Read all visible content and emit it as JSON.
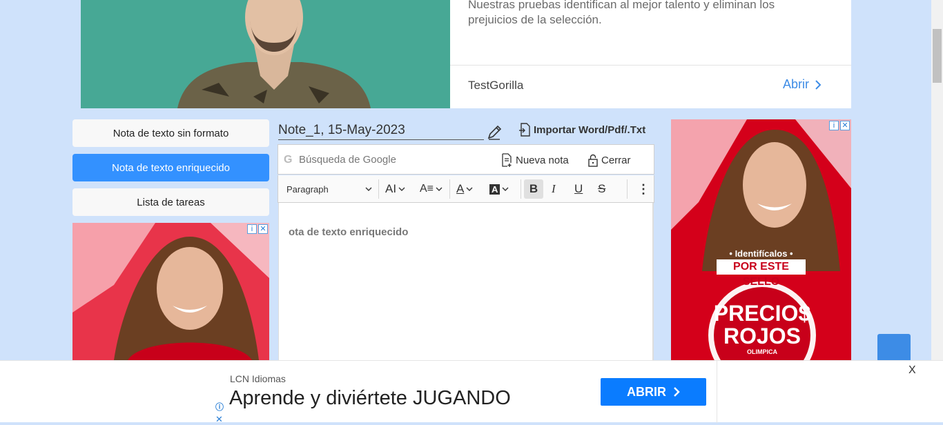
{
  "top_ad": {
    "text": "Nuestras pruebas identifican al mejor talento y eliminan los prejuicios de la selección.",
    "brand": "TestGorilla",
    "open_label": "Abrir"
  },
  "nav": {
    "plain": "Nota de texto sin formato",
    "rich": "Nota de texto enriquecido",
    "tasks": "Lista de tareas"
  },
  "editor": {
    "note_title": "Note_1, 15-May-2023",
    "import_label": "Importar Word/Pdf/.Txt",
    "search_placeholder": "Búsqueda de Google",
    "new_note_label": "Nueva nota",
    "close_label": "Cerrar",
    "toolbar": {
      "paragraph": "Paragraph"
    },
    "content": "ota de texto enriquecido"
  },
  "side_ad": {
    "tagline": "• Identifícalos •",
    "badge": "POR ESTE SELLO",
    "big": "PRECIO$ ROJOS",
    "brand": "OLIMPICA"
  },
  "bottom_ad": {
    "brand": "LCN Idiomas",
    "headline": "Aprende y diviértete JUGANDO",
    "open_label": "ABRIR",
    "close_label": "X"
  },
  "colors": {
    "accent": "#3391ff",
    "background": "#cfe2fb",
    "ad_red": "#d4001a"
  }
}
